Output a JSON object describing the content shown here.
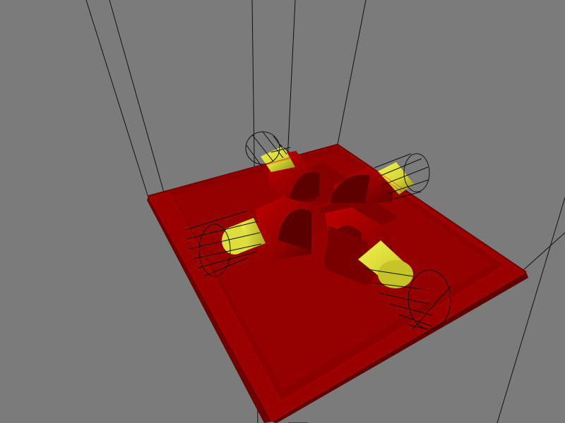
{
  "viewport": {
    "background_color": "#7b7b7b"
  },
  "scene": {
    "colors": {
      "base_red": "#990000",
      "base_dark": "#6e0000",
      "part_red": "#b80000",
      "part_dark": "#7c0000",
      "part_darker": "#590000",
      "rod_yellow": "#d7d735",
      "rod_light": "#f0f050",
      "rod_dark": "#8b8b12",
      "wire": "#111111"
    },
    "objects": [
      "base-plate",
      "cross-assembly",
      "yellow-rod",
      "wireframe-cylinder",
      "wireframe-guide-lines"
    ]
  }
}
